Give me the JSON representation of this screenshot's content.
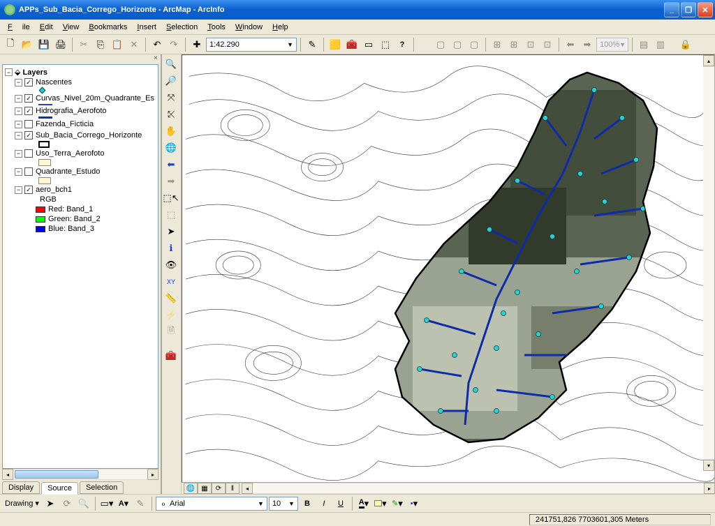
{
  "titlebar": {
    "title": "APPs_Sub_Bacia_Corrego_Horizonte - ArcMap - ArcInfo"
  },
  "menu": {
    "file": "File",
    "edit": "Edit",
    "view": "View",
    "bookmarks": "Bookmarks",
    "insert": "Insert",
    "selection": "Selection",
    "tools": "Tools",
    "window": "Window",
    "help": "Help"
  },
  "toolbar": {
    "scale": "1:42.290",
    "zoom_pct": "100%"
  },
  "toc": {
    "root": "Layers",
    "layers": [
      {
        "name": "Nascentes",
        "checked": true,
        "symbol": "point"
      },
      {
        "name": "Curvas_Nivel_20m_Quadrante_Es",
        "checked": true,
        "symbol": "line"
      },
      {
        "name": "Hidrografia_Aerofoto",
        "checked": true,
        "symbol": "blueline"
      },
      {
        "name": "Fazenda_Ficticia",
        "checked": false,
        "symbol": "none"
      },
      {
        "name": "Sub_Bacia_Corrego_Horizonte",
        "checked": true,
        "symbol": "box"
      },
      {
        "name": "Uso_Terra_Aerofoto",
        "checked": false,
        "symbol": "fill"
      },
      {
        "name": "Quadrante_Estudo",
        "checked": false,
        "symbol": "fill"
      },
      {
        "name": "aero_bch1",
        "checked": true,
        "symbol": "rgb"
      }
    ],
    "rgb": {
      "title": "RGB",
      "red": "Red:   Band_1",
      "green": "Green: Band_2",
      "blue": "Blue:   Band_3"
    },
    "tabs": {
      "display": "Display",
      "source": "Source",
      "selection": "Selection"
    }
  },
  "drawing": {
    "label": "Drawing",
    "font": "Arial",
    "size": "10"
  },
  "status": {
    "coords": "241751,826  7703601,305 Meters"
  }
}
